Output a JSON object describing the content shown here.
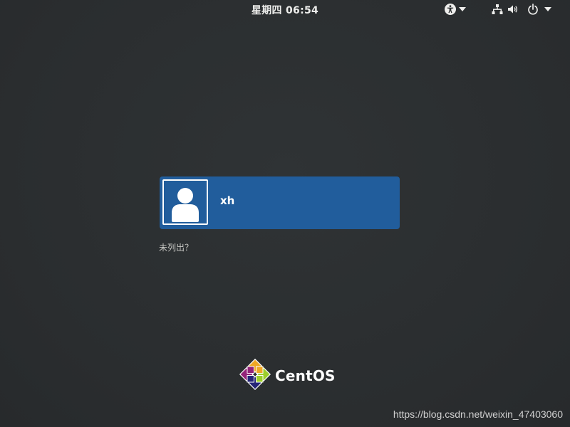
{
  "topbar": {
    "clock": "星期四 06:54",
    "icons": {
      "accessibility": "accessibility-icon",
      "network": "network-wired-icon",
      "volume": "volume-icon",
      "power": "power-icon",
      "dropdown": "chevron-down-icon"
    }
  },
  "login": {
    "users": [
      {
        "name": "xh",
        "avatar": "user-avatar-icon"
      }
    ],
    "not_listed_label": "未列出？"
  },
  "branding": {
    "logo_text": "CentOS",
    "logo_icon": "centos-logo-icon"
  },
  "watermark": "https://blog.csdn.net/weixin_47403060",
  "colors": {
    "background": "#2b2e30",
    "selected_user": "#215d9c",
    "text": "#ffffff"
  }
}
